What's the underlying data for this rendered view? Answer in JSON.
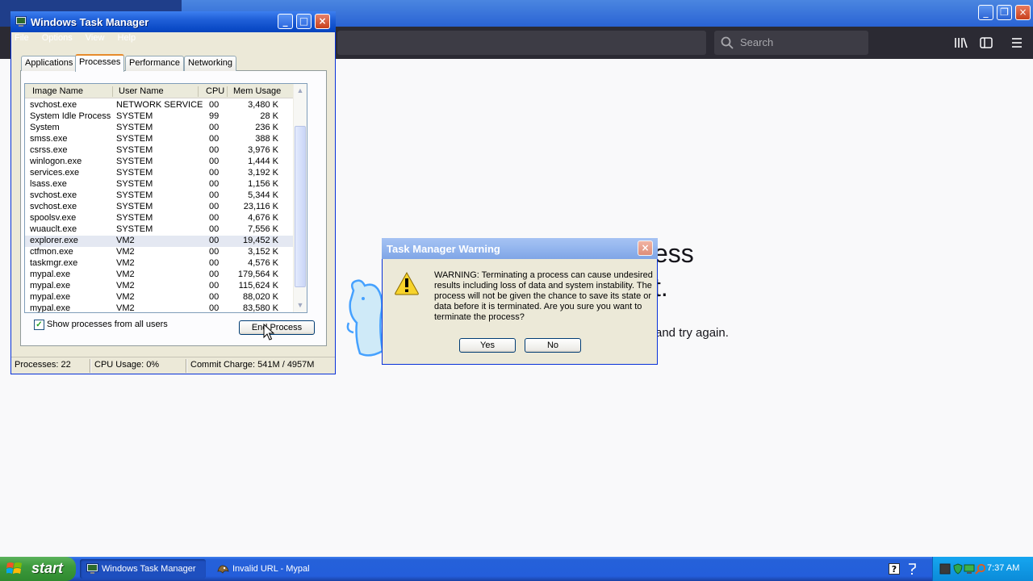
{
  "browser": {
    "search_placeholder": "Search",
    "heading_line1": "ess",
    "heading_line2": "t.",
    "body_fragment": "and try again."
  },
  "taskmgr": {
    "title": "Windows Task Manager",
    "menu": [
      "File",
      "Options",
      "View",
      "Help"
    ],
    "tabs": [
      "Applications",
      "Processes",
      "Performance",
      "Networking"
    ],
    "active_tab": "Processes",
    "columns": [
      "Image Name",
      "User Name",
      "CPU",
      "Mem Usage"
    ],
    "processes": [
      {
        "image": "svchost.exe",
        "user": "NETWORK SERVICE",
        "cpu": "00",
        "mem": "3,480 K"
      },
      {
        "image": "System Idle Process",
        "user": "SYSTEM",
        "cpu": "99",
        "mem": "28 K"
      },
      {
        "image": "System",
        "user": "SYSTEM",
        "cpu": "00",
        "mem": "236 K"
      },
      {
        "image": "smss.exe",
        "user": "SYSTEM",
        "cpu": "00",
        "mem": "388 K"
      },
      {
        "image": "csrss.exe",
        "user": "SYSTEM",
        "cpu": "00",
        "mem": "3,976 K"
      },
      {
        "image": "winlogon.exe",
        "user": "SYSTEM",
        "cpu": "00",
        "mem": "1,444 K"
      },
      {
        "image": "services.exe",
        "user": "SYSTEM",
        "cpu": "00",
        "mem": "3,192 K"
      },
      {
        "image": "lsass.exe",
        "user": "SYSTEM",
        "cpu": "00",
        "mem": "1,156 K"
      },
      {
        "image": "svchost.exe",
        "user": "SYSTEM",
        "cpu": "00",
        "mem": "5,344 K"
      },
      {
        "image": "svchost.exe",
        "user": "SYSTEM",
        "cpu": "00",
        "mem": "23,116 K"
      },
      {
        "image": "spoolsv.exe",
        "user": "SYSTEM",
        "cpu": "00",
        "mem": "4,676 K"
      },
      {
        "image": "wuauclt.exe",
        "user": "SYSTEM",
        "cpu": "00",
        "mem": "7,556 K"
      },
      {
        "image": "explorer.exe",
        "user": "VM2",
        "cpu": "00",
        "mem": "19,452 K"
      },
      {
        "image": "ctfmon.exe",
        "user": "VM2",
        "cpu": "00",
        "mem": "3,152 K"
      },
      {
        "image": "taskmgr.exe",
        "user": "VM2",
        "cpu": "00",
        "mem": "4,576 K"
      },
      {
        "image": "mypal.exe",
        "user": "VM2",
        "cpu": "00",
        "mem": "179,564 K"
      },
      {
        "image": "mypal.exe",
        "user": "VM2",
        "cpu": "00",
        "mem": "115,624 K"
      },
      {
        "image": "mypal.exe",
        "user": "VM2",
        "cpu": "00",
        "mem": "88,020 K"
      },
      {
        "image": "mypal.exe",
        "user": "VM2",
        "cpu": "00",
        "mem": "83,580 K"
      }
    ],
    "selected_process": "explorer.exe",
    "show_all_label": "Show processes from all users",
    "show_all_checked": true,
    "end_process_label": "End Process",
    "status": {
      "processes": "Processes: 22",
      "cpu": "CPU Usage: 0%",
      "commit": "Commit Charge: 541M / 4957M"
    }
  },
  "warning": {
    "title": "Task Manager Warning",
    "message": "WARNING: Terminating a process can cause undesired results including loss of data and system instability. The process will not be given the chance to save its state or data before it is terminated.  Are you sure you want to terminate the process?",
    "yes_label": "Yes",
    "no_label": "No",
    "icon": "warning-icon"
  },
  "taskbar": {
    "start_label": "start",
    "tasks": [
      {
        "label": "Windows Task Manager",
        "active": true
      },
      {
        "label": "Invalid URL - Mypal",
        "active": false
      }
    ],
    "clock": "7:37 AM"
  }
}
